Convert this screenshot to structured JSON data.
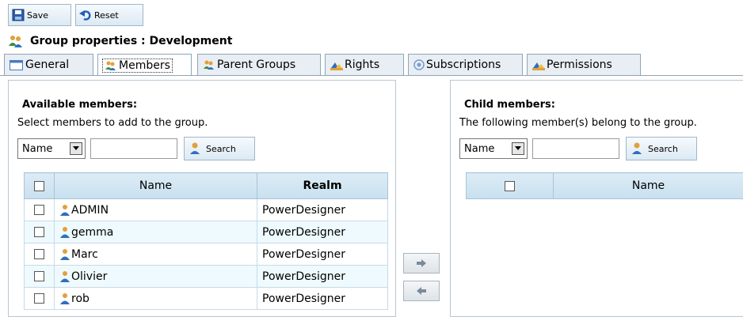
{
  "toolbar": {
    "save_label": "Save",
    "reset_label": "Reset"
  },
  "header": {
    "title": "Group properties :  Development"
  },
  "tabs": [
    {
      "label": "General",
      "icon": "general-icon"
    },
    {
      "label": "Members",
      "icon": "group-icon",
      "active": true
    },
    {
      "label": "Parent Groups",
      "icon": "group-icon"
    },
    {
      "label": "Rights",
      "icon": "rights-icon"
    },
    {
      "label": "Subscriptions",
      "icon": "subscriptions-icon"
    },
    {
      "label": "Permissions",
      "icon": "permissions-icon"
    }
  ],
  "available": {
    "title": "Available members:",
    "description": "Select members to add to the group.",
    "filter_selected": "Name",
    "search_value": "",
    "search_label": "Search",
    "columns": [
      "Name",
      "Realm"
    ],
    "rows": [
      {
        "name": "ADMIN",
        "realm": "PowerDesigner",
        "checked": false
      },
      {
        "name": "gemma",
        "realm": "PowerDesigner",
        "checked": false
      },
      {
        "name": "Marc",
        "realm": "PowerDesigner",
        "checked": false
      },
      {
        "name": "Olivier",
        "realm": "PowerDesigner",
        "checked": false
      },
      {
        "name": "rob",
        "realm": "PowerDesigner",
        "checked": false
      }
    ]
  },
  "child": {
    "title": "Child members:",
    "description": "The following member(s) belong to the group.",
    "filter_selected": "Name",
    "search_value": "",
    "search_label": "Search",
    "columns": [
      "Name"
    ],
    "rows": []
  },
  "colors": {
    "header_bg": "#c8e0ef",
    "row_alt_bg": "#eefafd",
    "border": "#a9c4d6"
  }
}
